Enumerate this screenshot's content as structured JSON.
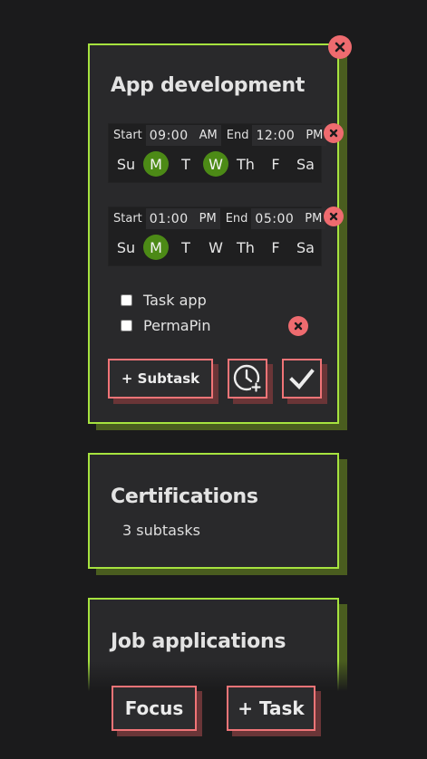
{
  "tasks": [
    {
      "title": "App development",
      "schedules": [
        {
          "start_label": "Start",
          "start_time": "09:00",
          "start_ampm": "AM",
          "end_label": "End",
          "end_time": "12:00",
          "end_ampm": "PM",
          "days": [
            "Su",
            "M",
            "T",
            "W",
            "Th",
            "F",
            "Sa"
          ],
          "active_days": [
            1,
            3
          ]
        },
        {
          "start_label": "Start",
          "start_time": "01:00",
          "start_ampm": "PM",
          "end_label": "End",
          "end_time": "05:00",
          "end_ampm": "PM",
          "days": [
            "Su",
            "M",
            "T",
            "W",
            "Th",
            "F",
            "Sa"
          ],
          "active_days": [
            1
          ]
        }
      ],
      "subtasks": [
        {
          "label": "Task app",
          "checked": false
        },
        {
          "label": "PermaPin",
          "checked": false
        }
      ],
      "buttons": {
        "add_subtask": "+ Subtask"
      }
    },
    {
      "title": "Certifications",
      "summary": "3 subtasks"
    },
    {
      "title": "Job applications"
    }
  ],
  "footer": {
    "focus": "Focus",
    "add_task": "+ Task"
  },
  "colors": {
    "card_border": "#a6e33f",
    "card_shadow": "#4a5d1f",
    "active_day": "#4c8a16",
    "button_border": "#f07477",
    "delete": "#ee6b6f"
  }
}
